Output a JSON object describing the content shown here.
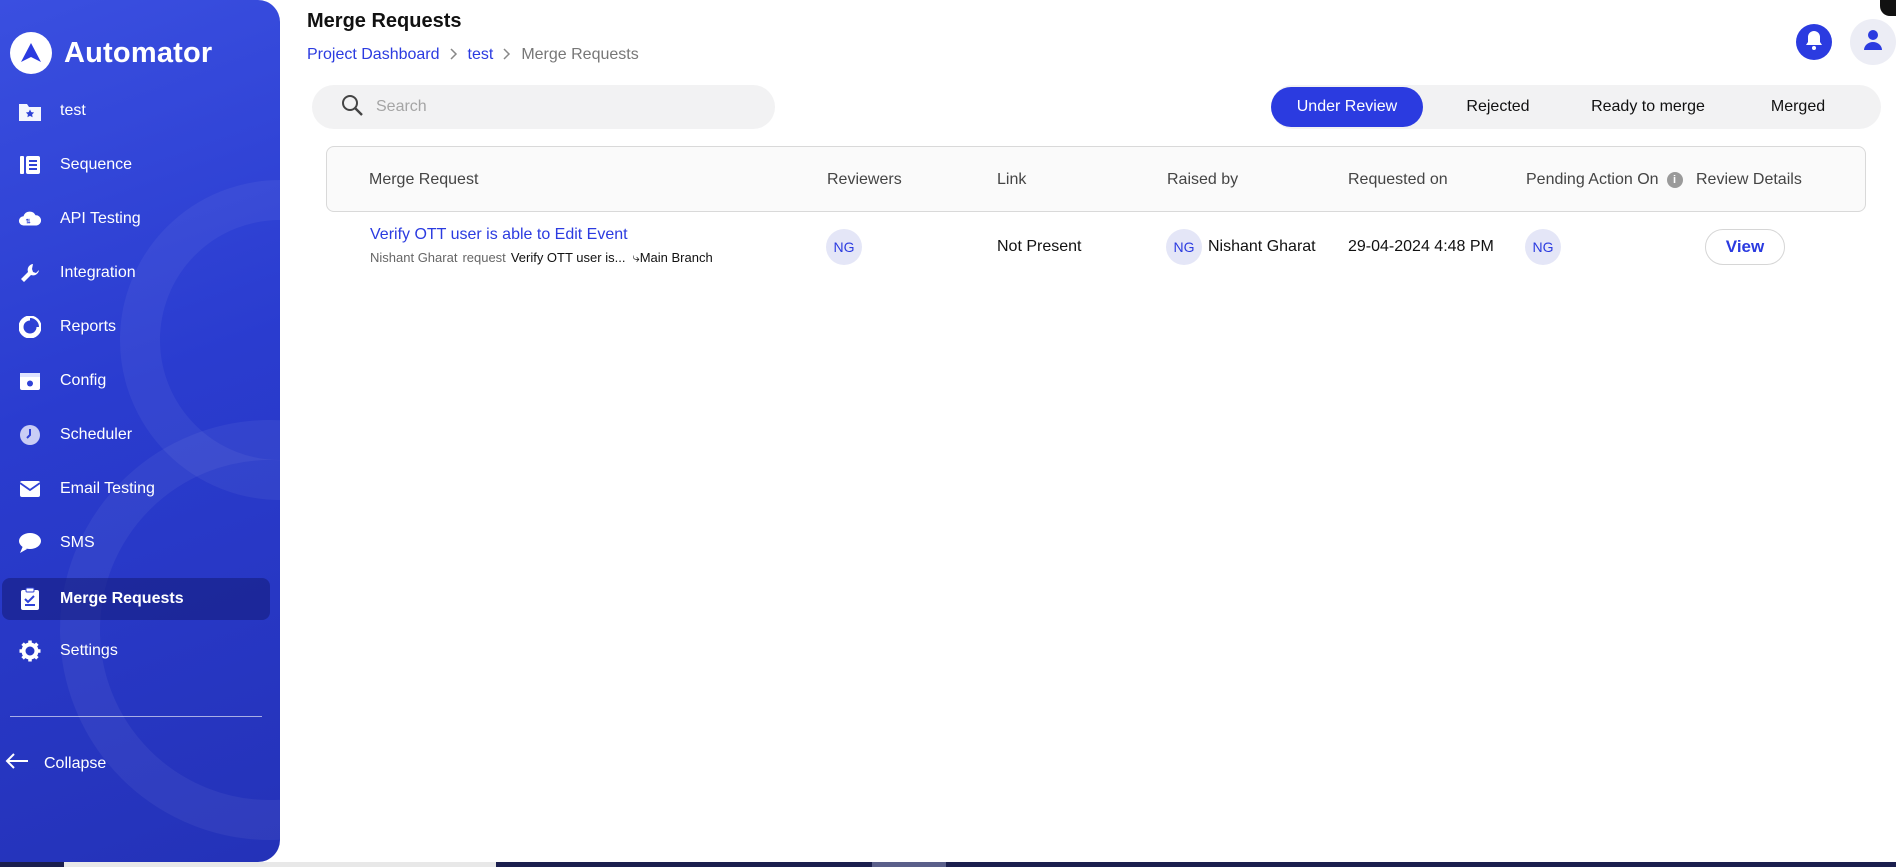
{
  "app": {
    "name": "Automator"
  },
  "sidebar": {
    "items": [
      {
        "label": "test",
        "icon": "folder-star-icon"
      },
      {
        "label": "Sequence",
        "icon": "sequence-icon"
      },
      {
        "label": "API Testing",
        "icon": "api-cloud-icon"
      },
      {
        "label": "Integration",
        "icon": "wrench-icon"
      },
      {
        "label": "Reports",
        "icon": "pie-chart-icon"
      },
      {
        "label": "Config",
        "icon": "config-icon"
      },
      {
        "label": "Scheduler",
        "icon": "clock-icon"
      },
      {
        "label": "Email Testing",
        "icon": "mail-icon"
      },
      {
        "label": "SMS",
        "icon": "chat-bubble-icon"
      },
      {
        "label": "Merge Requests",
        "icon": "clipboard-check-icon",
        "active": true
      },
      {
        "label": "Settings",
        "icon": "gear-icon"
      }
    ],
    "collapse_label": "Collapse"
  },
  "header": {
    "title": "Merge Requests",
    "breadcrumb": [
      "Project Dashboard",
      "test",
      "Merge Requests"
    ]
  },
  "search": {
    "placeholder": "Search",
    "value": ""
  },
  "tabs": [
    {
      "label": "Under Review",
      "active": true
    },
    {
      "label": "Rejected"
    },
    {
      "label": "Ready to merge"
    },
    {
      "label": "Merged"
    }
  ],
  "table": {
    "columns": [
      "Merge Request",
      "Reviewers",
      "Link",
      "Raised by",
      "Requested on",
      "Pending Action On",
      "Review Details"
    ],
    "rows": [
      {
        "title": "Verify OTT user is able to Edit Event",
        "requester": "Nishant Gharat",
        "request_word": "request",
        "request_item": "Verify OTT user is...",
        "branch": "⤷Main Branch",
        "reviewer_initials": "NG",
        "link": "Not Present",
        "raised_by_initials": "NG",
        "raised_by_name": "Nishant Gharat",
        "requested_on": "29-04-2024 4:48 PM",
        "pending_initials": "NG",
        "action_label": "View"
      }
    ]
  },
  "colors": {
    "accent": "#2b3be0",
    "sidebar": "#2a3ccf"
  }
}
